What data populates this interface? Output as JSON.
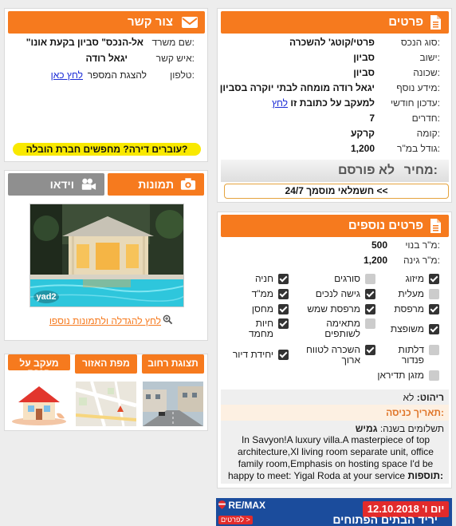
{
  "details": {
    "title": "פרטים",
    "rows": [
      {
        "label": "סוג הנכס:",
        "value": "פרטי/קוטג' להשכרה"
      },
      {
        "label": "ישוב:",
        "value": "סביון"
      },
      {
        "label": "שכונה:",
        "value": "סביון"
      },
      {
        "label": "מידע נוסף:",
        "value": "יגאל רודה מומחה לבתי יוקרה בסביון"
      },
      {
        "label": "עדכון חודשי:",
        "value": "למעקב על כתובת זו",
        "link": "לחץ"
      },
      {
        "label": "חדרים:",
        "value": "7"
      },
      {
        "label": "קומה:",
        "value": "קרקע"
      },
      {
        "label": "גודל במ\"ר:",
        "value": "1,200"
      }
    ],
    "price_label": "מחיר:",
    "price_value": "לא פורסם",
    "finance_button": "חשמלאי מוסמך 24/7 <<"
  },
  "contact": {
    "title": "צור קשר",
    "office_label": "שם משרד:",
    "office_value": "\"אל-הנכס\" סביון בקעת אונו",
    "person_label": "איש קשר:",
    "person_value": "יגאל רודה",
    "phone_label": "טלפון:",
    "phone_text": "להצגת המספר",
    "phone_link": "לחץ כאן",
    "moving_banner": "עוברים דירה? מחפשים חברת הובלה?"
  },
  "media": {
    "tab_photos": "תמונות",
    "tab_video": "וידאו",
    "watermark": "yad2",
    "enlarge_link": "לחץ להגדלה ולתמונות נוספו"
  },
  "map_tabs": [
    "תצוגת רחוב",
    "מפת האזור",
    "מעקב על הנכס"
  ],
  "extra": {
    "title": "פרטים נוספים",
    "built_label": "מ\"ר בנוי:",
    "built_value": "500",
    "garden_label": "מ\"ר גינה:",
    "garden_value": "1,200",
    "features": [
      [
        {
          "label": "מיזוג",
          "checked": true
        },
        {
          "label": "סורגים",
          "checked": false
        },
        {
          "label": "חניה",
          "checked": true
        }
      ],
      [
        {
          "label": "מעלית",
          "checked": false
        },
        {
          "label": "גישה לנכים",
          "checked": true
        },
        {
          "label": "ממ\"ד",
          "checked": true
        }
      ],
      [
        {
          "label": "מרפסת",
          "checked": true
        },
        {
          "label": "מרפסת שמש",
          "checked": true
        },
        {
          "label": "מחסן",
          "checked": true
        }
      ],
      [
        {
          "label": "משופצת",
          "checked": true
        },
        {
          "label": "מתאימה לשותפים",
          "checked": false
        },
        {
          "label": "חיות מחמד",
          "checked": true
        }
      ],
      [
        {
          "label": "דלתות פנדור",
          "checked": false
        },
        {
          "label": "השכרה לטווח ארוך",
          "checked": true
        },
        {
          "label": "יחידת דיור",
          "checked": true
        }
      ],
      [
        {
          "label": "מזגן תדיראן",
          "checked": false
        }
      ]
    ],
    "furnished_label": "ריהוט:",
    "furnished_value": "לא",
    "entry_label": "תאריך כניסה:",
    "payments_label": "תשלומים בשנה:",
    "payments_value": "גמיש",
    "additions_label": "תוספות:",
    "additions_text": "In Savyon!A luxury villa.A masterpiece of top architecture,Xl living room separate unit, office family room,Emphasis on hosting space I'd be happy to meet: Yigal Roda at your service"
  },
  "ad": {
    "brand": "RE/MAX",
    "date": "יום ו' 12.10.2018",
    "text": "יריד הבתים הפתוחים",
    "cta": "לפרטים >"
  }
}
